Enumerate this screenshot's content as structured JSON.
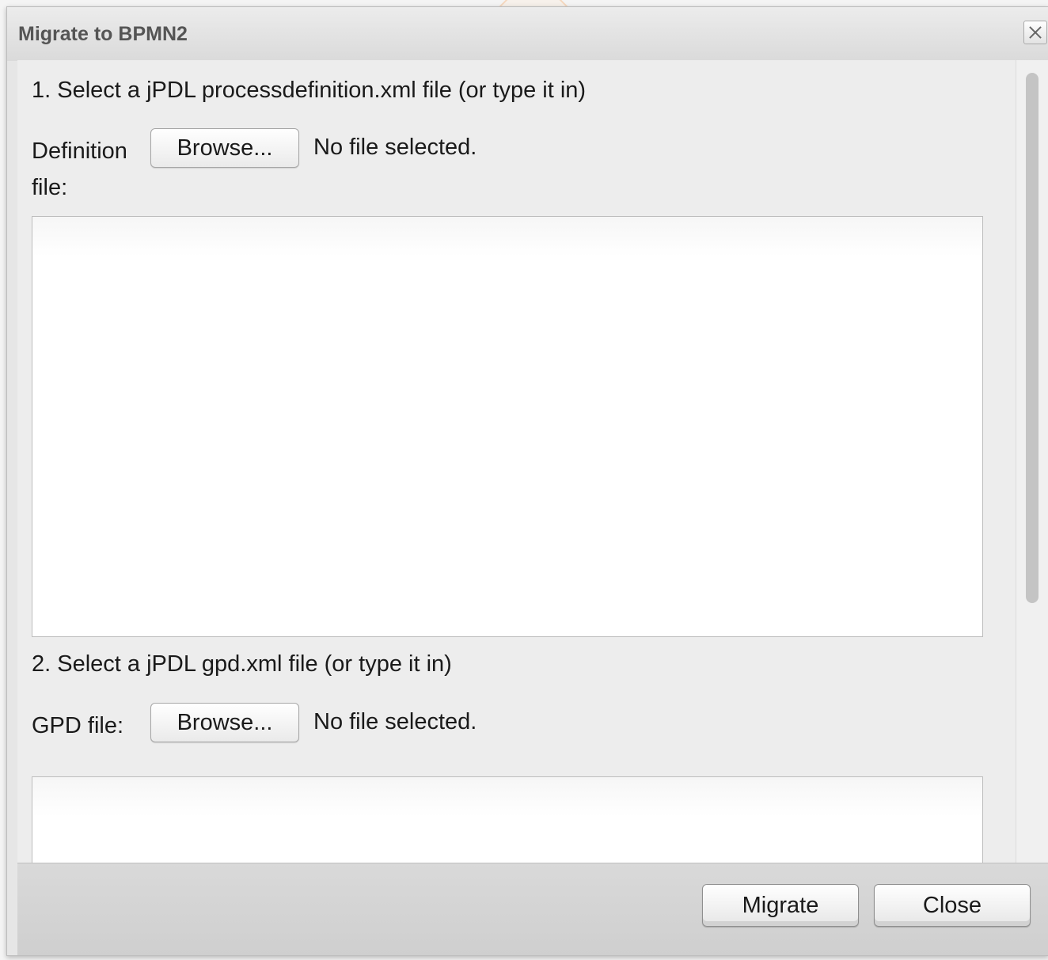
{
  "dialog": {
    "title": "Migrate to BPMN2",
    "close_icon": "close-icon"
  },
  "step1": {
    "heading": "1. Select a jPDL processdefinition.xml file (or type it in)",
    "label": "Definition file:",
    "browse_label": "Browse...",
    "status": "No file selected.",
    "textarea_value": ""
  },
  "step2": {
    "heading": "2. Select a jPDL gpd.xml file (or type it in)",
    "label": "GPD file:",
    "browse_label": "Browse...",
    "status": "No file selected.",
    "textarea_value": ""
  },
  "footer": {
    "migrate_label": "Migrate",
    "close_label": "Close"
  }
}
